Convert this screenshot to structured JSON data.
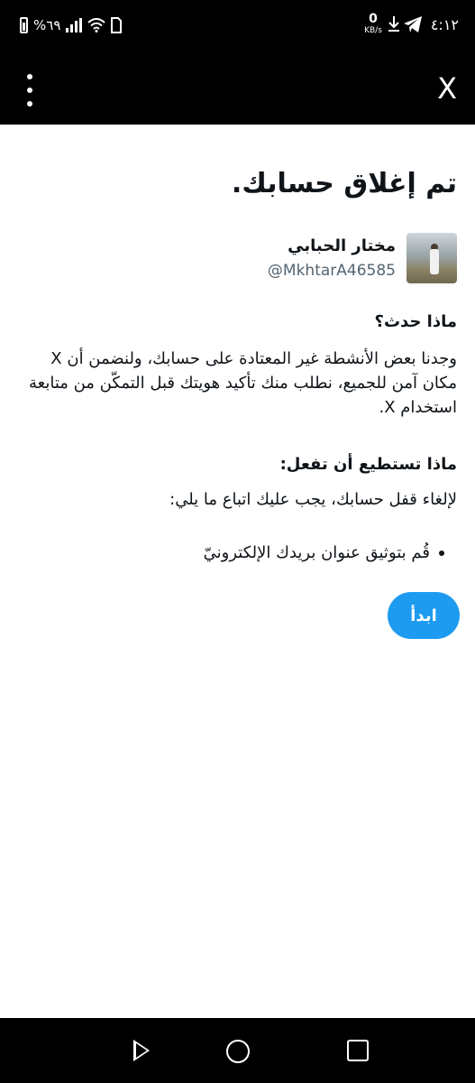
{
  "status_bar": {
    "time": "٤:١٢",
    "net_speed": "0",
    "net_unit": "KB/s",
    "battery": "%٦٩",
    "icons": [
      "telegram-icon",
      "download-icon",
      "wifi-icon",
      "signal-icon",
      "battery-icon"
    ]
  },
  "top_bar": {
    "close_label": "X",
    "icons": [
      "more-vertical-icon",
      "close-icon"
    ]
  },
  "page": {
    "title": "تم إغلاق حسابك.",
    "user": {
      "name": "مختار الحبابي",
      "handle": "@MkhtarA46585"
    },
    "what_happened_heading": "ماذا حدث؟",
    "what_happened_text": "وجدنا بعض الأنشطة غير المعتادة على حسابك، ولنضمن أن X مكان آمن للجميع، نطلب منك تأكيد هويتك قبل التمكّن من متابعة استخدام X.",
    "what_to_do_heading": "ماذا تستطيع أن تفعل:",
    "what_to_do_text": "لإلغاء قفل حسابك، يجب عليك اتباع ما يلي:",
    "steps": [
      "قُم بتوثيق عنوان بريدك الإلكترونيّ"
    ],
    "start_button": "ابدأ",
    "accent_color": "#1d9bf0"
  },
  "nav_bar": {
    "icons": [
      "back-icon",
      "home-icon",
      "recents-icon"
    ]
  }
}
